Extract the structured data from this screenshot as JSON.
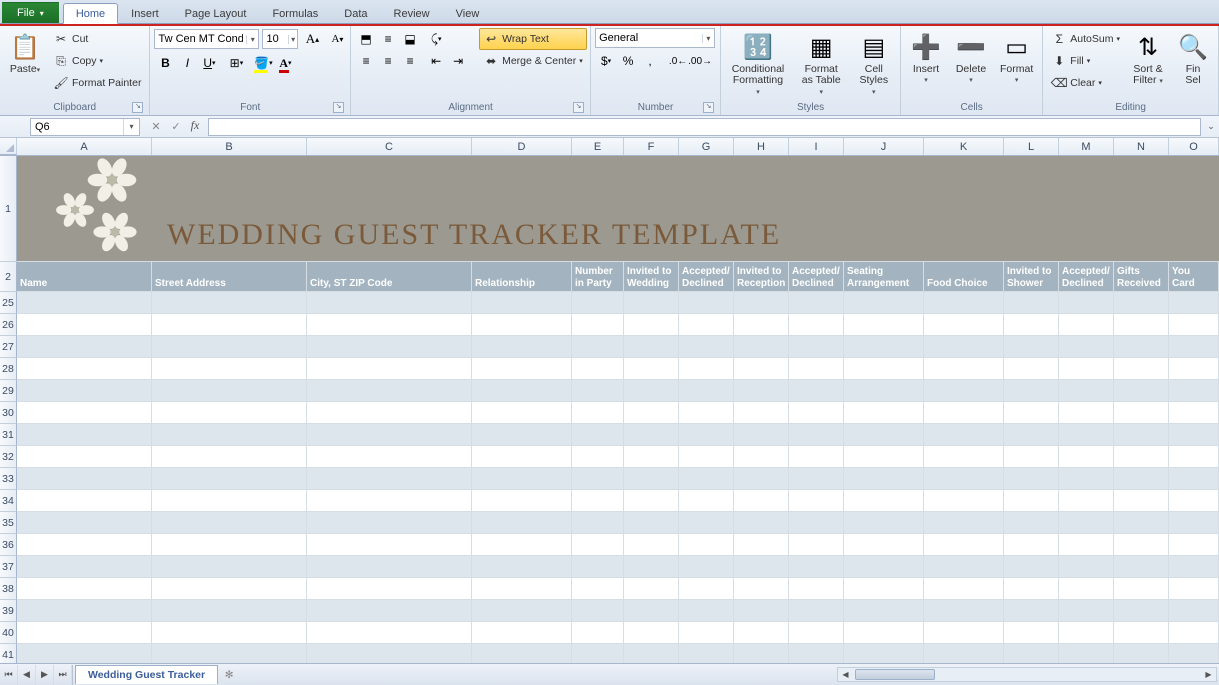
{
  "tabs": {
    "file": "File",
    "items": [
      "Home",
      "Insert",
      "Page Layout",
      "Formulas",
      "Data",
      "Review",
      "View"
    ],
    "active": "Home"
  },
  "ribbon": {
    "clipboard": {
      "label": "Clipboard",
      "paste": "Paste",
      "cut": "Cut",
      "copy": "Copy",
      "format_painter": "Format Painter"
    },
    "font": {
      "label": "Font",
      "name": "Tw Cen MT Conde",
      "size": "10",
      "bold": "B",
      "italic": "I",
      "underline": "U"
    },
    "alignment": {
      "label": "Alignment",
      "wrap": "Wrap Text",
      "merge": "Merge & Center"
    },
    "number": {
      "label": "Number",
      "format": "General"
    },
    "styles": {
      "label": "Styles",
      "cond": "Conditional",
      "cond2": "Formatting",
      "fmt": "Format",
      "fmt2": "as Table",
      "cell": "Cell",
      "cell2": "Styles"
    },
    "cells": {
      "label": "Cells",
      "insert": "Insert",
      "delete": "Delete",
      "format": "Format"
    },
    "editing": {
      "label": "Editing",
      "autosum": "AutoSum",
      "fill": "Fill",
      "clear": "Clear",
      "sort": "Sort &",
      "sort2": "Filter",
      "find": "Fin",
      "find2": "Sel"
    }
  },
  "name_box": "Q6",
  "formula": "",
  "columns": [
    {
      "l": "A",
      "w": 135
    },
    {
      "l": "B",
      "w": 155
    },
    {
      "l": "C",
      "w": 165
    },
    {
      "l": "D",
      "w": 100
    },
    {
      "l": "E",
      "w": 52
    },
    {
      "l": "F",
      "w": 55
    },
    {
      "l": "G",
      "w": 55
    },
    {
      "l": "H",
      "w": 55
    },
    {
      "l": "I",
      "w": 55
    },
    {
      "l": "J",
      "w": 80
    },
    {
      "l": "K",
      "w": 80
    },
    {
      "l": "L",
      "w": 55
    },
    {
      "l": "M",
      "w": 55
    },
    {
      "l": "N",
      "w": 55
    },
    {
      "l": "O",
      "w": 50
    }
  ],
  "title_text": "WEDDING GUEST TRACKER TEMPLATE",
  "row1_num": "1",
  "row2_num": "2",
  "headers": [
    "Name",
    "Street Address",
    "City, ST  ZIP Code",
    "Relationship",
    "Number in Party",
    "Invited to Wedding",
    "Accepted/ Declined",
    "Invited to Reception",
    "Accepted/ Declined",
    "Seating Arrangement",
    "Food Choice",
    "Invited to Shower",
    "Accepted/ Declined",
    "Gifts Received",
    "Thank You Card"
  ],
  "data_row_numbers": [
    "25",
    "26",
    "27",
    "28",
    "29",
    "30",
    "31",
    "32",
    "33",
    "34",
    "35",
    "36",
    "37",
    "38",
    "39",
    "40",
    "41"
  ],
  "sheet_tab": "Wedding Guest Tracker"
}
